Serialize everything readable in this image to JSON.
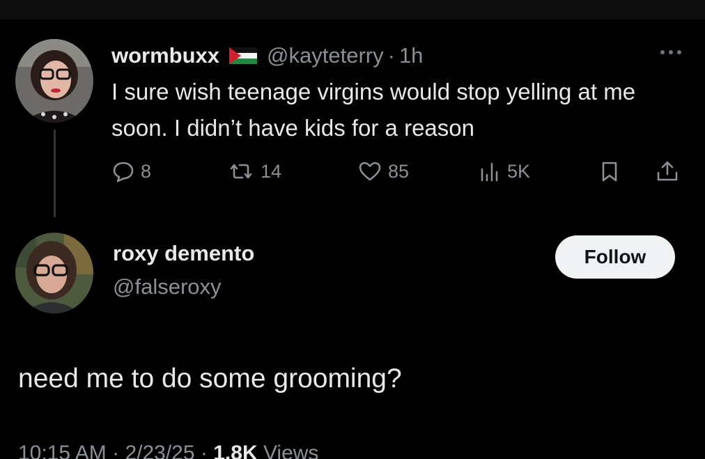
{
  "reply_to_tweet": {
    "author": {
      "display_name": "wormbuxx",
      "flag_icon": "palestine-flag-icon",
      "handle": "@kayteterry",
      "separator": "·",
      "time": "1h"
    },
    "text": "I sure wish teenage virgins would stop yelling at me soon. I didn’t have kids for a reason",
    "actions": {
      "replies": "8",
      "reposts": "14",
      "likes": "85",
      "views": "5K"
    }
  },
  "main_tweet": {
    "author": {
      "display_name": "roxy demento",
      "handle": "@falseroxy"
    },
    "follow_label": "Follow",
    "text": "need me to do some grooming?",
    "meta": {
      "time": "10:15 AM",
      "separator": "·",
      "date": "2/23/25",
      "views": "1.8K",
      "views_label": "Views"
    }
  },
  "colors": {
    "background": "#000000",
    "primary_text": "#e7e9ea",
    "secondary_text": "#8b9096",
    "follow_button": "#eff3f4"
  }
}
